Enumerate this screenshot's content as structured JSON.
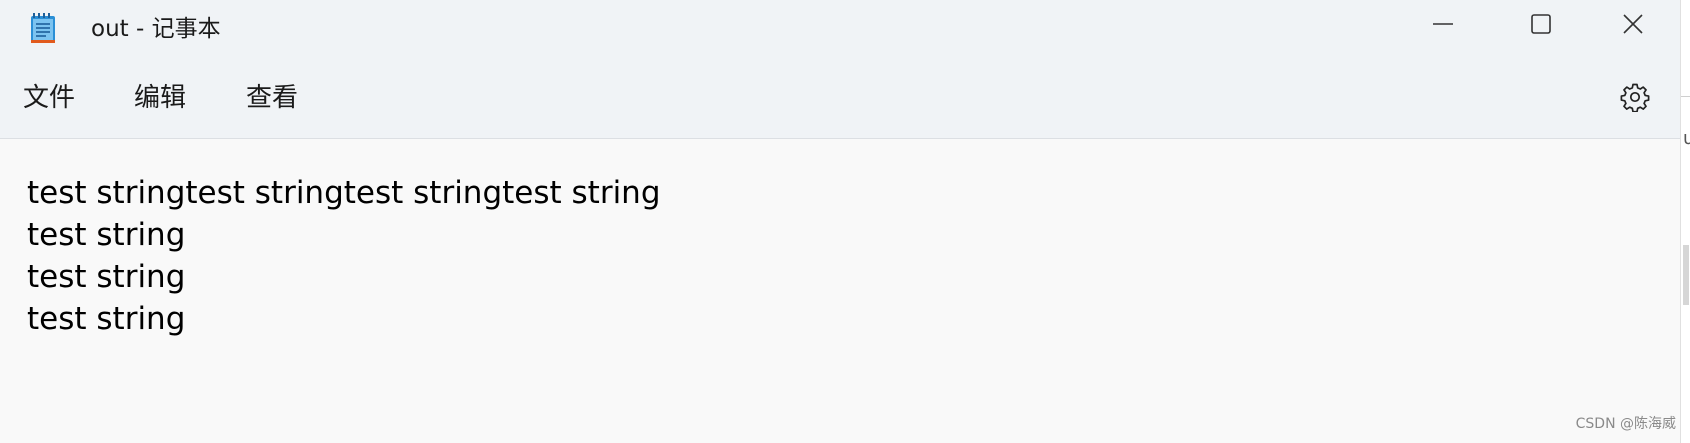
{
  "window": {
    "title": "out - 记事本",
    "app_icon": "notepad-icon",
    "controls": {
      "minimize_icon": "minimize-icon",
      "maximize_icon": "maximize-icon",
      "close_icon": "close-icon"
    }
  },
  "menubar": {
    "items": [
      {
        "label": "文件"
      },
      {
        "label": "编辑"
      },
      {
        "label": "查看"
      }
    ],
    "settings_icon": "gear-icon"
  },
  "editor": {
    "lines": [
      "test stringtest stringtest stringtest string",
      "test string",
      "test string",
      "test string"
    ]
  },
  "edge": {
    "glyph": "u"
  },
  "watermark": {
    "text": "CSDN @陈海威"
  },
  "colors": {
    "chrome_bg": "#f0f3f6",
    "editor_bg": "#f9f9f9",
    "icon_blue": "#2b8fd6",
    "icon_orange": "#e15a1d"
  }
}
